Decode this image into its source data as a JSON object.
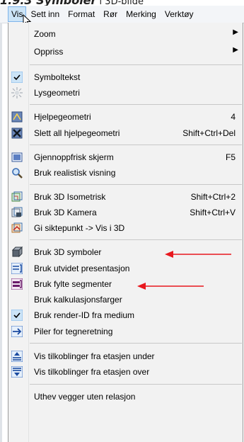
{
  "top_cut": {
    "text": "1.9.3 Symboler",
    "rest": " i 3D-bilde"
  },
  "menubar": {
    "items": [
      {
        "label": "Vis"
      },
      {
        "label": "Sett inn"
      },
      {
        "label": "Format"
      },
      {
        "label": "Rør"
      },
      {
        "label": "Merking"
      },
      {
        "label": "Verktøy"
      }
    ]
  },
  "menu": {
    "zoom": "Zoom",
    "oppriss": "Oppriss",
    "symboltekst": "Symboltekst",
    "lysgeometri": "Lysgeometri",
    "hjelpegeometri": "Hjelpegeometri",
    "hjelpegeometri_shortcut": "4",
    "slett_hjelpegeometri": "Slett all hjelpegeometri",
    "slett_hjelpegeometri_shortcut": "Shift+Ctrl+Del",
    "gjennoppfrisk": "Gjennoppfrisk skjerm",
    "gjennoppfrisk_shortcut": "F5",
    "realistisk": "Bruk realistisk visning",
    "isometrisk": "Bruk 3D Isometrisk",
    "isometrisk_shortcut": "Shift+Ctrl+2",
    "kamera": "Bruk 3D Kamera",
    "kamera_shortcut": "Shift+Ctrl+V",
    "siktepunkt": "Gi siktepunkt -> Vis i 3D",
    "symboler3d": "Bruk 3D symboler",
    "utvidet": "Bruk utvidet presentasjon",
    "fylte": "Bruk fylte segmenter",
    "kalkulasjon": "Bruk kalkulasjonsfarger",
    "renderid": "Bruk render-ID fra medium",
    "piler": "Piler for tegneretning",
    "tilk_under": "Vis tilkoblinger fra etasjen under",
    "tilk_over": "Vis tilkoblinger fra etasjen over",
    "uthev": "Uthev vegger uten relasjon"
  },
  "colors": {
    "highlight": "#cce4f7",
    "annotation": "#e8181e",
    "menu_bg": "#f2f2f2"
  }
}
